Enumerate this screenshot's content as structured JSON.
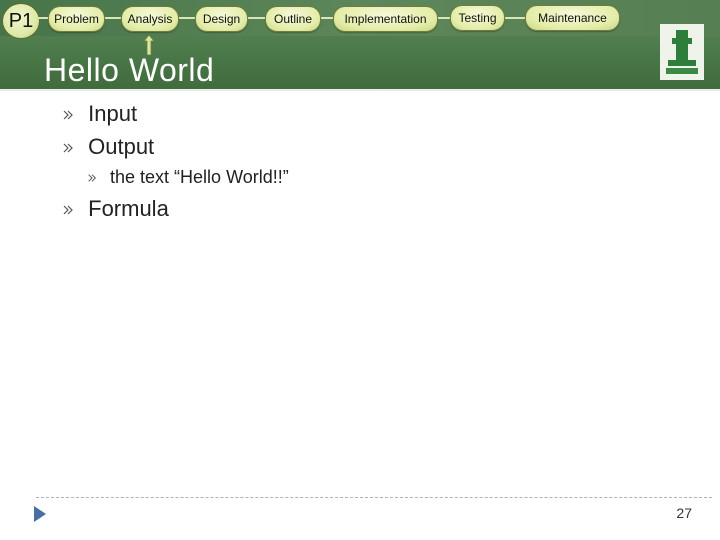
{
  "header": {
    "badge": "P1",
    "steps": [
      {
        "label": "Problem"
      },
      {
        "label": "Analysis"
      },
      {
        "label": "Design"
      },
      {
        "label": "Outline"
      },
      {
        "label": "Implementation"
      },
      {
        "label": "Testing"
      },
      {
        "label": "Maintenance"
      }
    ],
    "current_step": "Analysis"
  },
  "slide": {
    "title": "Hello World",
    "bullets": [
      {
        "text": "Input"
      },
      {
        "text": "Output",
        "children": [
          {
            "text": "the text “Hello World!!”"
          }
        ]
      },
      {
        "text": "Formula"
      }
    ],
    "page_number": "27"
  },
  "colors": {
    "header_green": "#4d7a4a",
    "step_fill": "#e4eda9",
    "footer_accent": "#496ea3"
  }
}
